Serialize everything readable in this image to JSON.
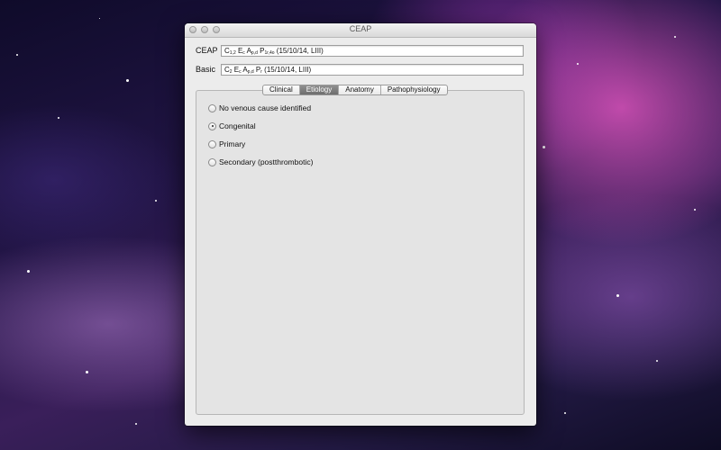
{
  "window": {
    "title": "CEAP"
  },
  "fields": {
    "ceap": {
      "label": "CEAP",
      "value_parts": [
        {
          "text": "C",
          "sub": false
        },
        {
          "text": "1,2",
          "sub": true
        },
        {
          "text": " E",
          "sub": false
        },
        {
          "text": "c",
          "sub": true
        },
        {
          "text": " A",
          "sub": false
        },
        {
          "text": "p,d",
          "sub": true
        },
        {
          "text": " P",
          "sub": false
        },
        {
          "text": "1r,4o",
          "sub": true
        },
        {
          "text": " (15/10/14, LIII)",
          "sub": false
        }
      ]
    },
    "basic": {
      "label": "Basic",
      "value_parts": [
        {
          "text": "C",
          "sub": false
        },
        {
          "text": "2",
          "sub": true
        },
        {
          "text": " E",
          "sub": false
        },
        {
          "text": "c",
          "sub": true
        },
        {
          "text": " A",
          "sub": false
        },
        {
          "text": "p,d",
          "sub": true
        },
        {
          "text": " P",
          "sub": false
        },
        {
          "text": "r",
          "sub": true
        },
        {
          "text": " (15/10/14, LIII)",
          "sub": false
        }
      ]
    }
  },
  "tabs": [
    {
      "label": "Clinical",
      "active": false
    },
    {
      "label": "Etiology",
      "active": true
    },
    {
      "label": "Anatomy",
      "active": false
    },
    {
      "label": "Pathophysiology",
      "active": false
    }
  ],
  "etiology_options": [
    {
      "label": "No venous cause identified",
      "checked": false
    },
    {
      "label": "Congenital",
      "checked": true
    },
    {
      "label": "Primary",
      "checked": false
    },
    {
      "label": "Secondary (postthrombotic)",
      "checked": false
    }
  ],
  "colors": {
    "active_tab": "#7d7d7d",
    "window_bg": "#ececec",
    "panel_bg": "#e4e4e4"
  }
}
